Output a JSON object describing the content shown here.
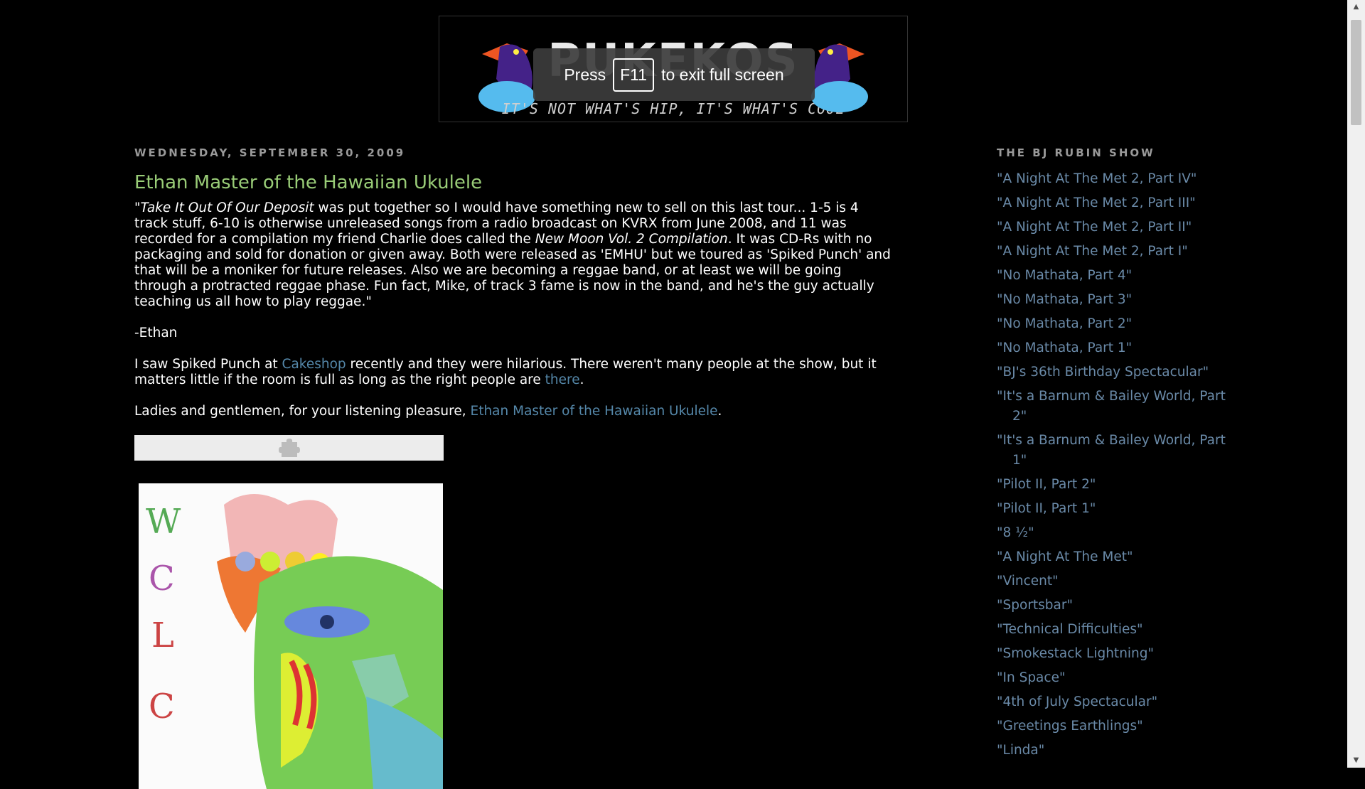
{
  "header": {
    "title": "PUKEKOS",
    "tagline": "IT'S NOT WHAT'S HIP, IT'S WHAT'S COOL"
  },
  "fullscreen_toast": {
    "press": "Press",
    "key": "F11",
    "rest": "to exit full screen"
  },
  "post": {
    "date": "WEDNESDAY, SEPTEMBER 30, 2009",
    "title": "Ethan Master of the Hawaiian Ukulele",
    "p1": {
      "quote_open": "\"",
      "album": "Take It Out Of Our Deposit",
      "text1": " was put together so I would have something new to sell on this last tour... 1-5 is 4 track stuff, 6-10 is otherwise unreleased songs from a radio broadcast on KVRX from June 2008, and 11 was recorded for a compilation my friend Charlie does called the ",
      "compilation": "New Moon Vol. 2 Compilation",
      "text2": ". It was CD-Rs with no packaging and sold for donation or given away. Both were released as 'EMHU' but we toured as 'Spiked Punch' and that will be a moniker for future releases. Also we are becoming a reggae band, or at least we will be going through a protracted reggae phase. Fun fact, Mike, of track 3 fame is now in the band, and he's the guy actually teaching us all how to play reggae.\""
    },
    "signature": "-Ethan",
    "p3": {
      "text1": "I saw Spiked Punch at ",
      "link1": "Cakeshop",
      "text2": " recently and they were hilarious. There weren't many people at the show, but it matters little if the room is full as long as the right people are ",
      "link2": "there",
      "text3": "."
    },
    "p4": {
      "text1": "Ladies and gentlemen, for your listening pleasure, ",
      "link": "Ethan Master of the Hawaiian Ukulele",
      "text2": "."
    }
  },
  "sidebar": {
    "title": "THE BJ RUBIN SHOW",
    "items": [
      "\"A Night At The Met 2, Part IV\"",
      "\"A Night At The Met 2, Part III\"",
      "\"A Night At The Met 2, Part II\"",
      "\"A Night At The Met 2, Part I\"",
      "\"No Mathata, Part 4\"",
      "\"No Mathata, Part 3\"",
      "\"No Mathata, Part 2\"",
      "\"No Mathata, Part 1\"",
      "\"BJ's 36th Birthday Spectacular\"",
      "\"It's a Barnum & Bailey World, Part 2\"",
      "\"It's a Barnum & Bailey World, Part 1\"",
      "\"Pilot II, Part 2\"",
      "\"Pilot II, Part 1\"",
      "\"8 ½\"",
      "\"A Night At The Met\"",
      "\"Vincent\"",
      "\"Sportsbar\"",
      "\"Technical Difficulties\"",
      "\"Smokestack Lightning\"",
      "\"In Space\"",
      "\"4th of July Spectacular\"",
      "\"Greetings Earthlings\"",
      "\"Linda\""
    ]
  },
  "colors": {
    "background": "#000000",
    "title_green": "#99cc77",
    "link_blue": "#5588aa",
    "sidebar_link": "#6a8aa8"
  }
}
